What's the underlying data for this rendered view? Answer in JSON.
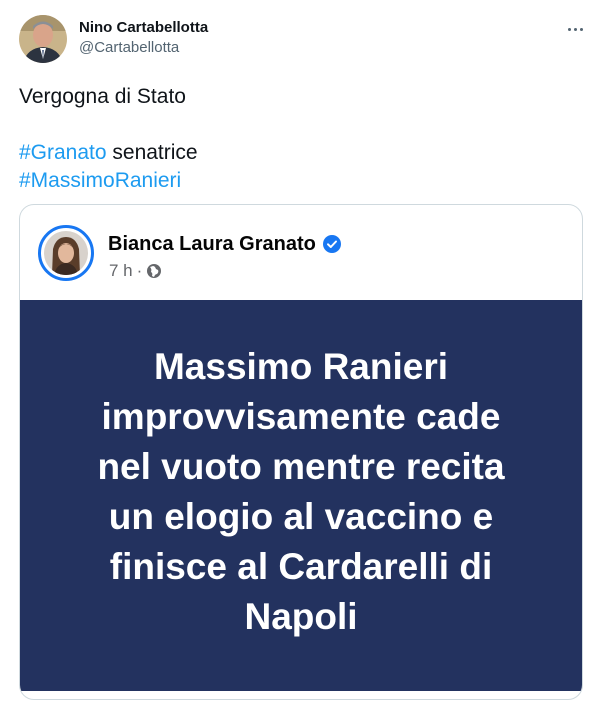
{
  "author": {
    "name": "Nino Cartabellotta",
    "handle": "@Cartabellotta"
  },
  "tweet": {
    "line1": "Vergogna di Stato",
    "hashtag1": "#Granato",
    "line2_rest": " senatrice",
    "hashtag2": "#MassimoRanieri"
  },
  "quoted_post": {
    "name": "Bianca Laura Granato",
    "time": "7 h",
    "separator": "·",
    "image_text": "Massimo Ranieri\nimprovvisamente cade\nnel vuoto mentre recita\nun elogio al vaccino e\nfinisce al Cardarelli di\nNapoli",
    "image_bg_color": "#23325f"
  },
  "icons": {
    "more": "more-dots-icon",
    "verified": "verified-badge-icon",
    "audience": "globe-icon"
  },
  "colors": {
    "link": "#1d9bf0",
    "facebook_blue": "#1877f2"
  }
}
